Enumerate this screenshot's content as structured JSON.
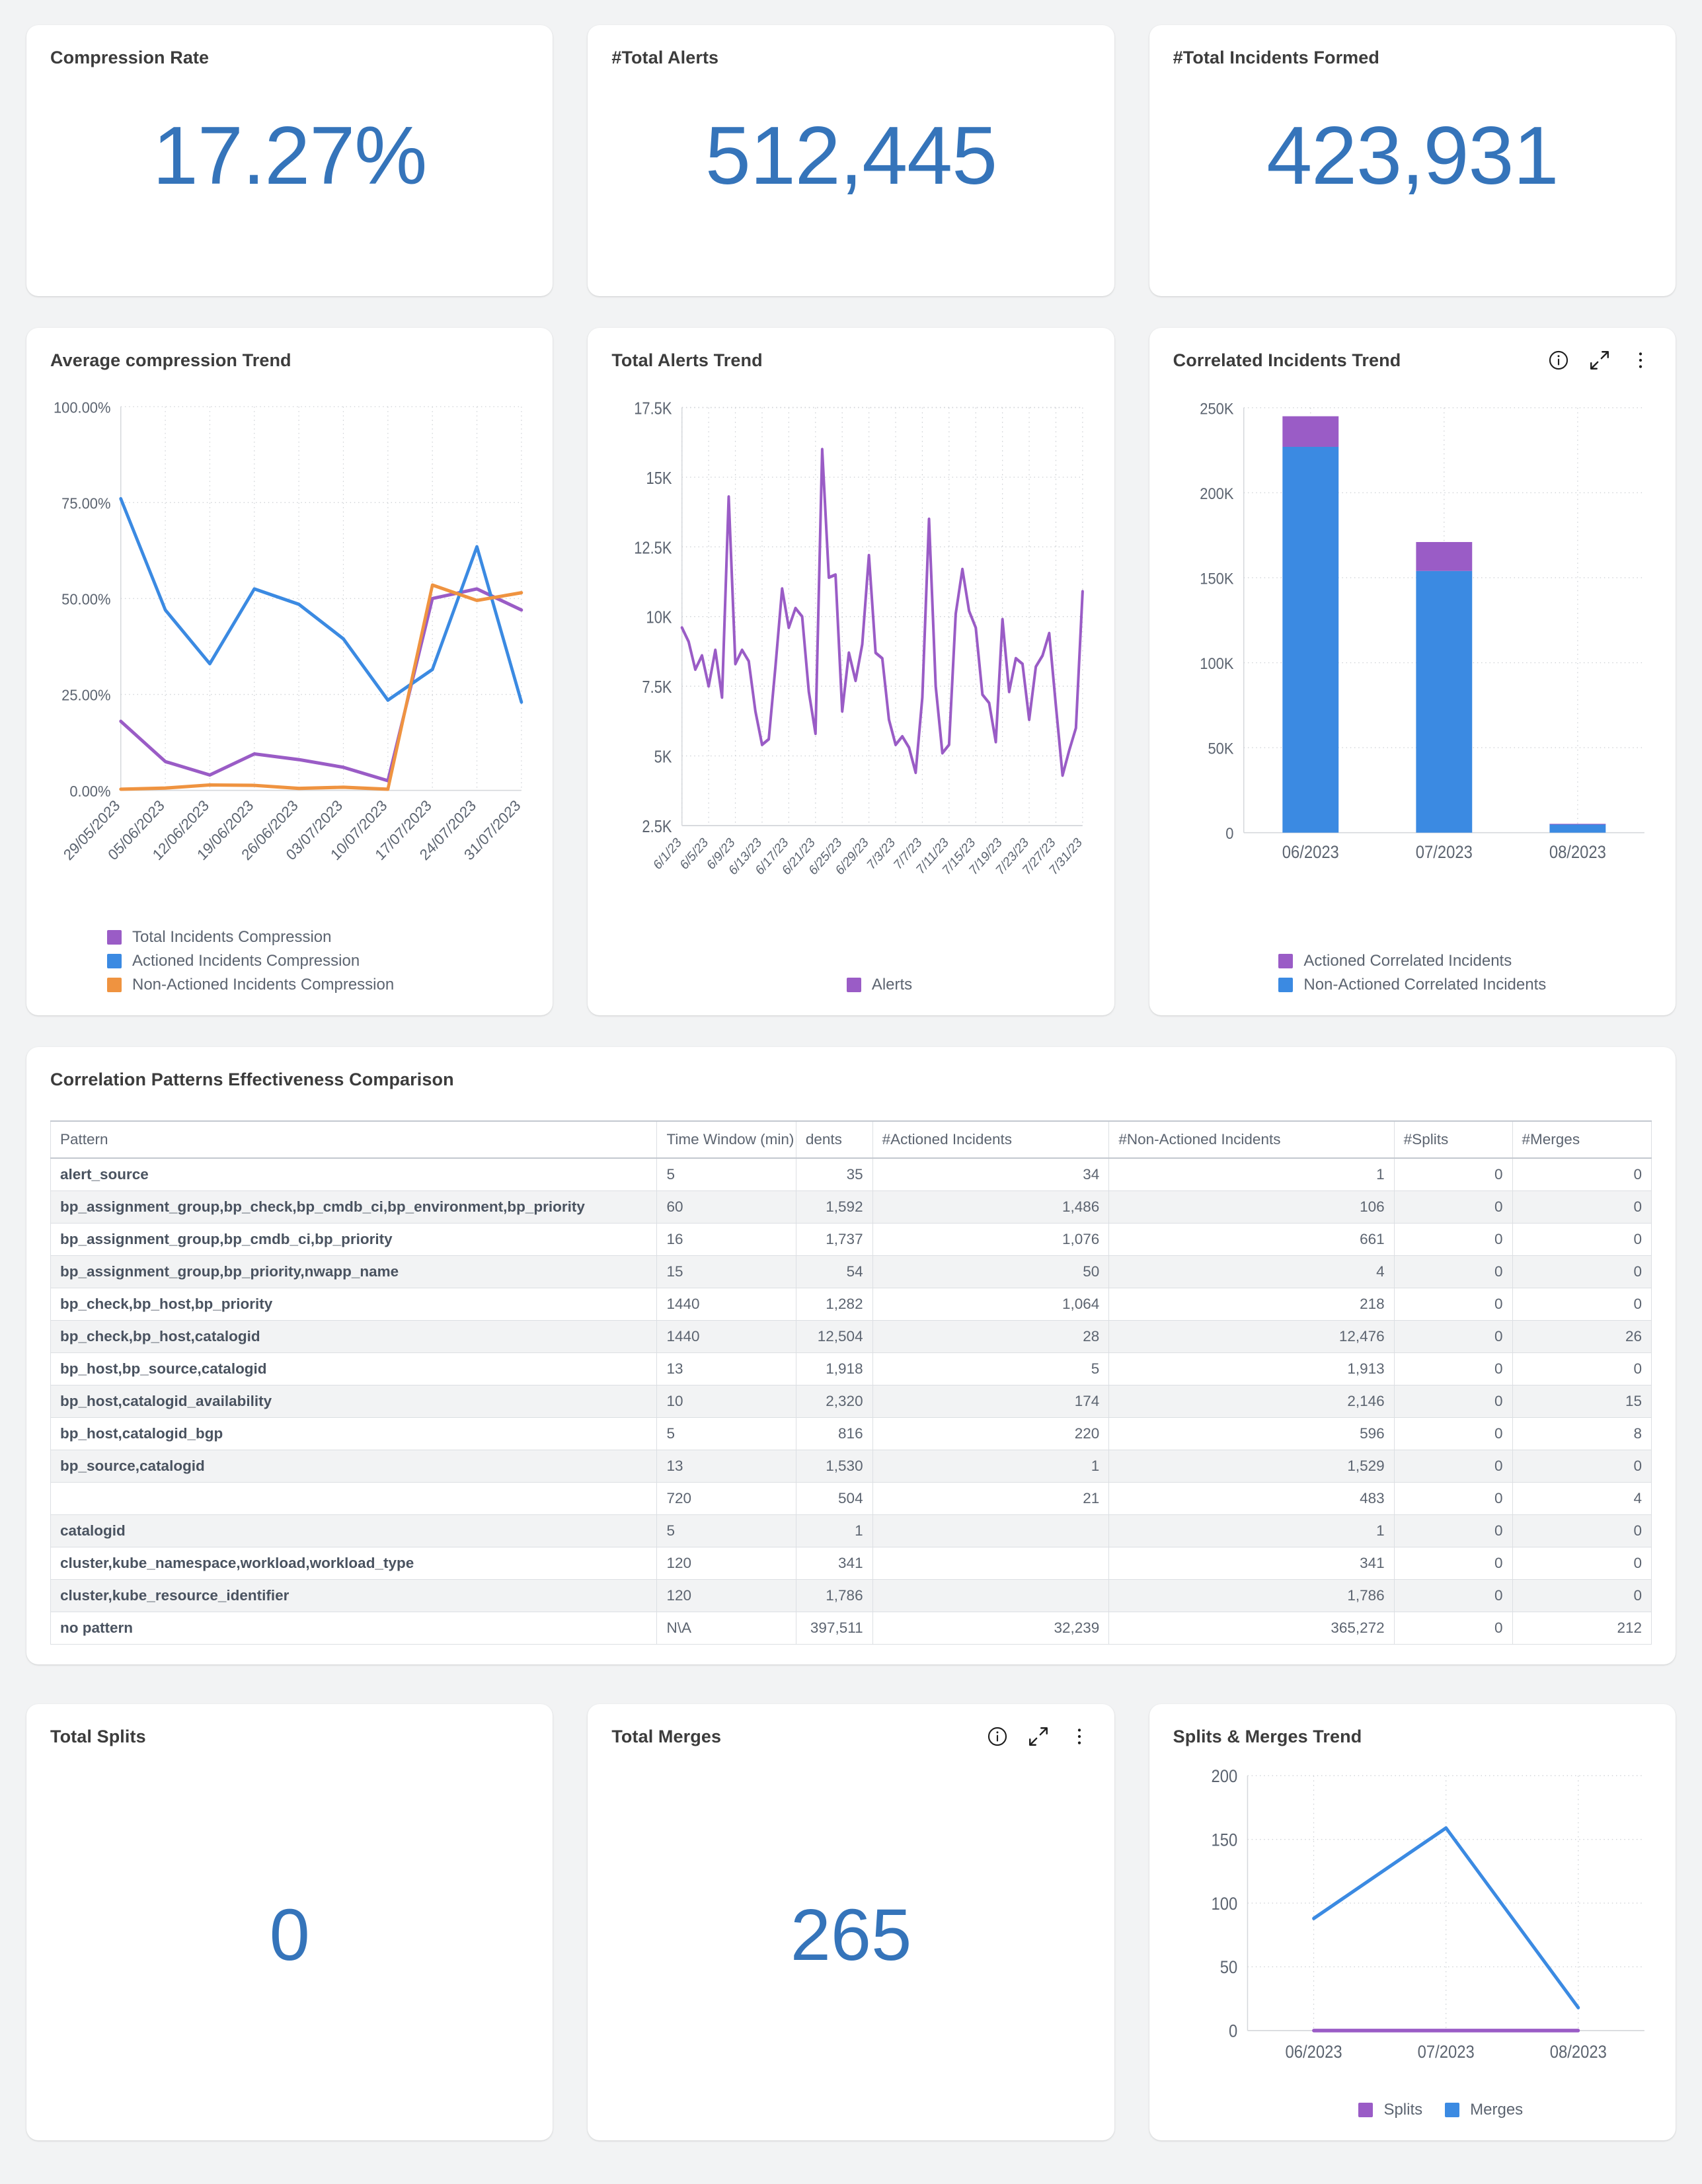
{
  "kpis": [
    {
      "title": "Compression Rate",
      "value": "17.27%"
    },
    {
      "title": "#Total Alerts",
      "value": "512,445"
    },
    {
      "title": "#Total Incidents Formed",
      "value": "423,931"
    }
  ],
  "colors": {
    "purple": "#9a5cc6",
    "blue": "#3b8ae2",
    "orange": "#ef9340",
    "kpi_blue": "#3574ba",
    "grid": "#d6d8dc",
    "text": "#5c6470"
  },
  "panels": {
    "avg_compression": {
      "title": "Average compression Trend"
    },
    "total_alerts": {
      "title": "Total Alerts Trend"
    },
    "correlated": {
      "title": "Correlated Incidents Trend",
      "icons": {
        "info": "info-circle-icon",
        "expand": "expand-icon",
        "more": "kebab-menu-icon"
      }
    },
    "total_splits": {
      "title": "Total Splits",
      "value": "0"
    },
    "total_merges": {
      "title": "Total Merges",
      "value": "265",
      "icons": {
        "info": "info-circle-icon",
        "expand": "expand-icon",
        "more": "kebab-menu-icon"
      }
    },
    "splits_merges": {
      "title": "Splits & Merges Trend"
    }
  },
  "table": {
    "title": "Correlation Patterns Effectiveness Comparison",
    "columns": [
      "Pattern",
      "Time Window (min)",
      "dents",
      "#Actioned Incidents",
      "#Non-Actioned Incidents",
      "#Splits",
      "#Merges"
    ],
    "column_full_names": [
      "Pattern",
      "Time Window (min)",
      "#Total Incidents",
      "#Actioned Incidents",
      "#Non-Actioned Incidents",
      "#Splits",
      "#Merges"
    ],
    "rows": [
      {
        "pattern": "alert_source",
        "window": "5",
        "total": "35",
        "actioned": "34",
        "nonactioned": "1",
        "splits": "0",
        "merges": "0"
      },
      {
        "pattern": "bp_assignment_group,bp_check,bp_cmdb_ci,bp_environment,bp_priority",
        "window": "60",
        "total": "1,592",
        "actioned": "1,486",
        "nonactioned": "106",
        "splits": "0",
        "merges": "0"
      },
      {
        "pattern": "bp_assignment_group,bp_cmdb_ci,bp_priority",
        "window": "16",
        "total": "1,737",
        "actioned": "1,076",
        "nonactioned": "661",
        "splits": "0",
        "merges": "0"
      },
      {
        "pattern": "bp_assignment_group,bp_priority,nwapp_name",
        "window": "15",
        "total": "54",
        "actioned": "50",
        "nonactioned": "4",
        "splits": "0",
        "merges": "0"
      },
      {
        "pattern": "bp_check,bp_host,bp_priority",
        "window": "1440",
        "total": "1,282",
        "actioned": "1,064",
        "nonactioned": "218",
        "splits": "0",
        "merges": "0"
      },
      {
        "pattern": "bp_check,bp_host,catalogid",
        "window": "1440",
        "total": "12,504",
        "actioned": "28",
        "nonactioned": "12,476",
        "splits": "0",
        "merges": "26"
      },
      {
        "pattern": "bp_host,bp_source,catalogid",
        "window": "13",
        "total": "1,918",
        "actioned": "5",
        "nonactioned": "1,913",
        "splits": "0",
        "merges": "0"
      },
      {
        "pattern": "bp_host,catalogid_availability",
        "window": "10",
        "total": "2,320",
        "actioned": "174",
        "nonactioned": "2,146",
        "splits": "0",
        "merges": "15"
      },
      {
        "pattern": "bp_host,catalogid_bgp",
        "window": "5",
        "total": "816",
        "actioned": "220",
        "nonactioned": "596",
        "splits": "0",
        "merges": "8"
      },
      {
        "pattern": "bp_source,catalogid",
        "window": "13",
        "total": "1,530",
        "actioned": "1",
        "nonactioned": "1,529",
        "splits": "0",
        "merges": "0"
      },
      {
        "pattern": "",
        "window": "720",
        "total": "504",
        "actioned": "21",
        "nonactioned": "483",
        "splits": "0",
        "merges": "4"
      },
      {
        "pattern": "catalogid",
        "window": "5",
        "total": "1",
        "actioned": "",
        "nonactioned": "1",
        "splits": "0",
        "merges": "0"
      },
      {
        "pattern": "cluster,kube_namespace,workload,workload_type",
        "window": "120",
        "total": "341",
        "actioned": "",
        "nonactioned": "341",
        "splits": "0",
        "merges": "0"
      },
      {
        "pattern": "cluster,kube_resource_identifier",
        "window": "120",
        "total": "1,786",
        "actioned": "",
        "nonactioned": "1,786",
        "splits": "0",
        "merges": "0"
      },
      {
        "pattern": "no pattern",
        "window": "N\\A",
        "total": "397,511",
        "actioned": "32,239",
        "nonactioned": "365,272",
        "splits": "0",
        "merges": "212"
      }
    ]
  },
  "chart_data": [
    {
      "id": "avg_compression",
      "type": "line",
      "title": "Average compression Trend",
      "xlabel": "",
      "ylabel": "",
      "ylim": [
        0,
        100
      ],
      "yticks": [
        "0.00%",
        "25.00%",
        "50.00%",
        "75.00%",
        "100.00%"
      ],
      "ytick_values": [
        0,
        25,
        50,
        75,
        100
      ],
      "grid": true,
      "legend_position": "bottom-left",
      "categories": [
        "29/05/2023",
        "05/06/2023",
        "12/06/2023",
        "19/06/2023",
        "26/06/2023",
        "03/07/2023",
        "10/07/2023",
        "17/07/2023",
        "24/07/2023",
        "31/07/2023"
      ],
      "series": [
        {
          "name": "Total Incidents Compression",
          "color": "#9a5cc6",
          "values": [
            18.0,
            7.5,
            4.0,
            9.5,
            8.0,
            6.0,
            2.5,
            50.0,
            52.5,
            47.0
          ]
        },
        {
          "name": "Actioned Incidents Compression",
          "color": "#3b8ae2",
          "values": [
            76.0,
            47.0,
            33.0,
            52.5,
            48.5,
            39.5,
            23.5,
            31.5,
            63.5,
            23.0
          ]
        },
        {
          "name": "Non-Actioned Incidents Compression",
          "color": "#ef9340",
          "values": [
            0.3,
            0.6,
            1.4,
            1.3,
            0.5,
            0.8,
            0.3,
            53.5,
            49.5,
            51.5
          ]
        }
      ]
    },
    {
      "id": "total_alerts",
      "type": "line",
      "title": "Total Alerts Trend",
      "xlabel": "",
      "ylabel": "",
      "ylim": [
        2500,
        17500
      ],
      "yticks": [
        "2.5K",
        "5K",
        "7.5K",
        "10K",
        "12.5K",
        "15K",
        "17.5K"
      ],
      "ytick_values": [
        2500,
        5000,
        7500,
        10000,
        12500,
        15000,
        17500
      ],
      "grid": true,
      "legend_position": "bottom-center",
      "categories": [
        "6/1/23",
        "6/2/23",
        "6/3/23",
        "6/4/23",
        "6/5/23",
        "6/6/23",
        "6/7/23",
        "6/8/23",
        "6/9/23",
        "6/10/23",
        "6/11/23",
        "6/12/23",
        "6/13/23",
        "6/14/23",
        "6/15/23",
        "6/16/23",
        "6/17/23",
        "6/18/23",
        "6/19/23",
        "6/20/23",
        "6/21/23",
        "6/22/23",
        "6/23/23",
        "6/24/23",
        "6/25/23",
        "6/26/23",
        "6/27/23",
        "6/28/23",
        "6/29/23",
        "6/30/23",
        "7/1/23",
        "7/2/23",
        "7/3/23",
        "7/4/23",
        "7/5/23",
        "7/6/23",
        "7/7/23",
        "7/8/23",
        "7/9/23",
        "7/10/23",
        "7/11/23",
        "7/12/23",
        "7/13/23",
        "7/14/23",
        "7/15/23",
        "7/16/23",
        "7/17/23",
        "7/18/23",
        "7/19/23",
        "7/20/23",
        "7/21/23",
        "7/22/23",
        "7/23/23",
        "7/24/23",
        "7/25/23",
        "7/26/23",
        "7/27/23",
        "7/28/23",
        "7/29/23",
        "7/30/23",
        "7/31/23"
      ],
      "xtick_labels": [
        "6/1/23",
        "6/5/23",
        "6/9/23",
        "6/13/23",
        "6/17/23",
        "6/21/23",
        "6/25/23",
        "6/29/23",
        "7/3/23",
        "7/7/23",
        "7/11/23",
        "7/15/23",
        "7/19/23",
        "7/23/23",
        "7/27/23",
        "7/31/23"
      ],
      "series": [
        {
          "name": "Alerts",
          "color": "#9a5cc6",
          "values": [
            9600,
            9100,
            8100,
            8600,
            7500,
            8800,
            7100,
            14300,
            8300,
            8800,
            8400,
            6600,
            5400,
            5600,
            8200,
            11000,
            9600,
            10300,
            10000,
            7300,
            5800,
            16000,
            11400,
            11500,
            6600,
            8700,
            7700,
            9000,
            12200,
            8700,
            8500,
            6300,
            5400,
            5700,
            5300,
            4400,
            7100,
            13500,
            7500,
            5100,
            5400,
            10100,
            11700,
            10200,
            9600,
            7200,
            6900,
            5500,
            9900,
            7300,
            8500,
            8300,
            6300,
            8200,
            8600,
            9400,
            6800,
            4300,
            5200,
            6000,
            10900
          ]
        }
      ]
    },
    {
      "id": "correlated",
      "type": "bar",
      "title": "Correlated Incidents Trend",
      "stacked": true,
      "xlabel": "",
      "ylabel": "",
      "ylim": [
        0,
        250000
      ],
      "yticks": [
        "0",
        "50K",
        "100K",
        "150K",
        "200K",
        "250K"
      ],
      "ytick_values": [
        0,
        50000,
        100000,
        150000,
        200000,
        250000
      ],
      "grid": true,
      "legend_position": "bottom-center",
      "categories": [
        "06/2023",
        "07/2023",
        "08/2023"
      ],
      "series": [
        {
          "name": "Non-Actioned Correlated Incidents",
          "color": "#3b8ae2",
          "values": [
            227000,
            154000,
            5000
          ]
        },
        {
          "name": "Actioned Correlated Incidents",
          "color": "#9a5cc6",
          "values": [
            18000,
            17000,
            200
          ]
        }
      ]
    },
    {
      "id": "splits_merges",
      "type": "line",
      "title": "Splits & Merges Trend",
      "xlabel": "",
      "ylabel": "",
      "ylim": [
        0,
        200
      ],
      "yticks": [
        "0",
        "50",
        "100",
        "150",
        "200"
      ],
      "ytick_values": [
        0,
        50,
        100,
        150,
        200
      ],
      "grid": true,
      "legend_position": "bottom-center",
      "categories": [
        "06/2023",
        "07/2023",
        "08/2023"
      ],
      "series": [
        {
          "name": "Splits",
          "color": "#9a5cc6",
          "values": [
            0,
            0,
            0
          ]
        },
        {
          "name": "Merges",
          "color": "#3b8ae2",
          "values": [
            88,
            159,
            18
          ]
        }
      ]
    }
  ]
}
